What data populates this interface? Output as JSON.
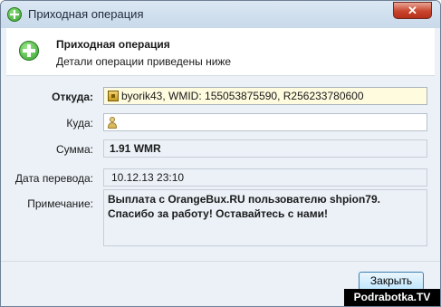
{
  "window": {
    "title": "Приходная операция"
  },
  "header": {
    "title": "Приходная операция",
    "subtitle": "Детали операции приведены ниже"
  },
  "form": {
    "from": {
      "label": "Откуда:",
      "value": "byorik43, WMID: 155053875590, R256233780600"
    },
    "to": {
      "label": "Куда:",
      "value": ""
    },
    "amount": {
      "label": "Сумма:",
      "value": "1.91 WMR"
    },
    "date": {
      "label": "Дата перевода:",
      "value": "10.12.13 23:10"
    },
    "note": {
      "label": "Примечание:",
      "value": "Выплата с OrangeBux.RU пользователю  shpion79. Спасибо за работу! Оставайтесь с нами!"
    }
  },
  "footer": {
    "close_label": "Закрыть"
  },
  "watermark": "Podrabotka.TV",
  "icons": {
    "window": "add-green-icon",
    "header": "add-green-icon",
    "from": "wallet-icon",
    "to": "person-icon"
  }
}
